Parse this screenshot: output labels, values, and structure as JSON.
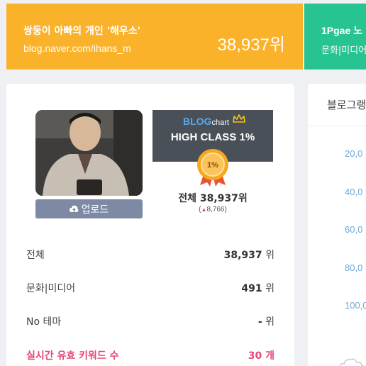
{
  "banner_left": {
    "title": "쌍둥이 아빠의 개인 '해우소'",
    "url": "blog.naver.com/ihans_m",
    "rank": "38,937위"
  },
  "banner_right": {
    "title": "1Pgae 노",
    "subtitle": "문화|미디어"
  },
  "profile": {
    "upload_label": "업로드"
  },
  "blogchart": {
    "logo_blog": "BLOG",
    "logo_chart": "chart",
    "grade": "HIGH CLASS 1%",
    "medal_text": "1%"
  },
  "total": {
    "rank": "전체 38,937위",
    "change_arrow": "▲",
    "change": "8,766"
  },
  "stats": [
    {
      "label": "전체",
      "value": "38,937",
      "unit": "위"
    },
    {
      "label": "문화|미디어",
      "value": "491",
      "unit": "위"
    },
    {
      "label": "No 테마",
      "value": "-",
      "unit": "위"
    },
    {
      "label": "실시간 유효 키워드 수",
      "value": "30",
      "unit": "개"
    }
  ],
  "right_panel": {
    "title": "블로그랭",
    "ticks": [
      "20,0",
      "40,0",
      "60,0",
      "80,0",
      "100,0"
    ]
  },
  "colors": {
    "orange": "#fbb22b",
    "green": "#27c391",
    "pink": "#e8457a",
    "upload": "#7e8aa4"
  }
}
